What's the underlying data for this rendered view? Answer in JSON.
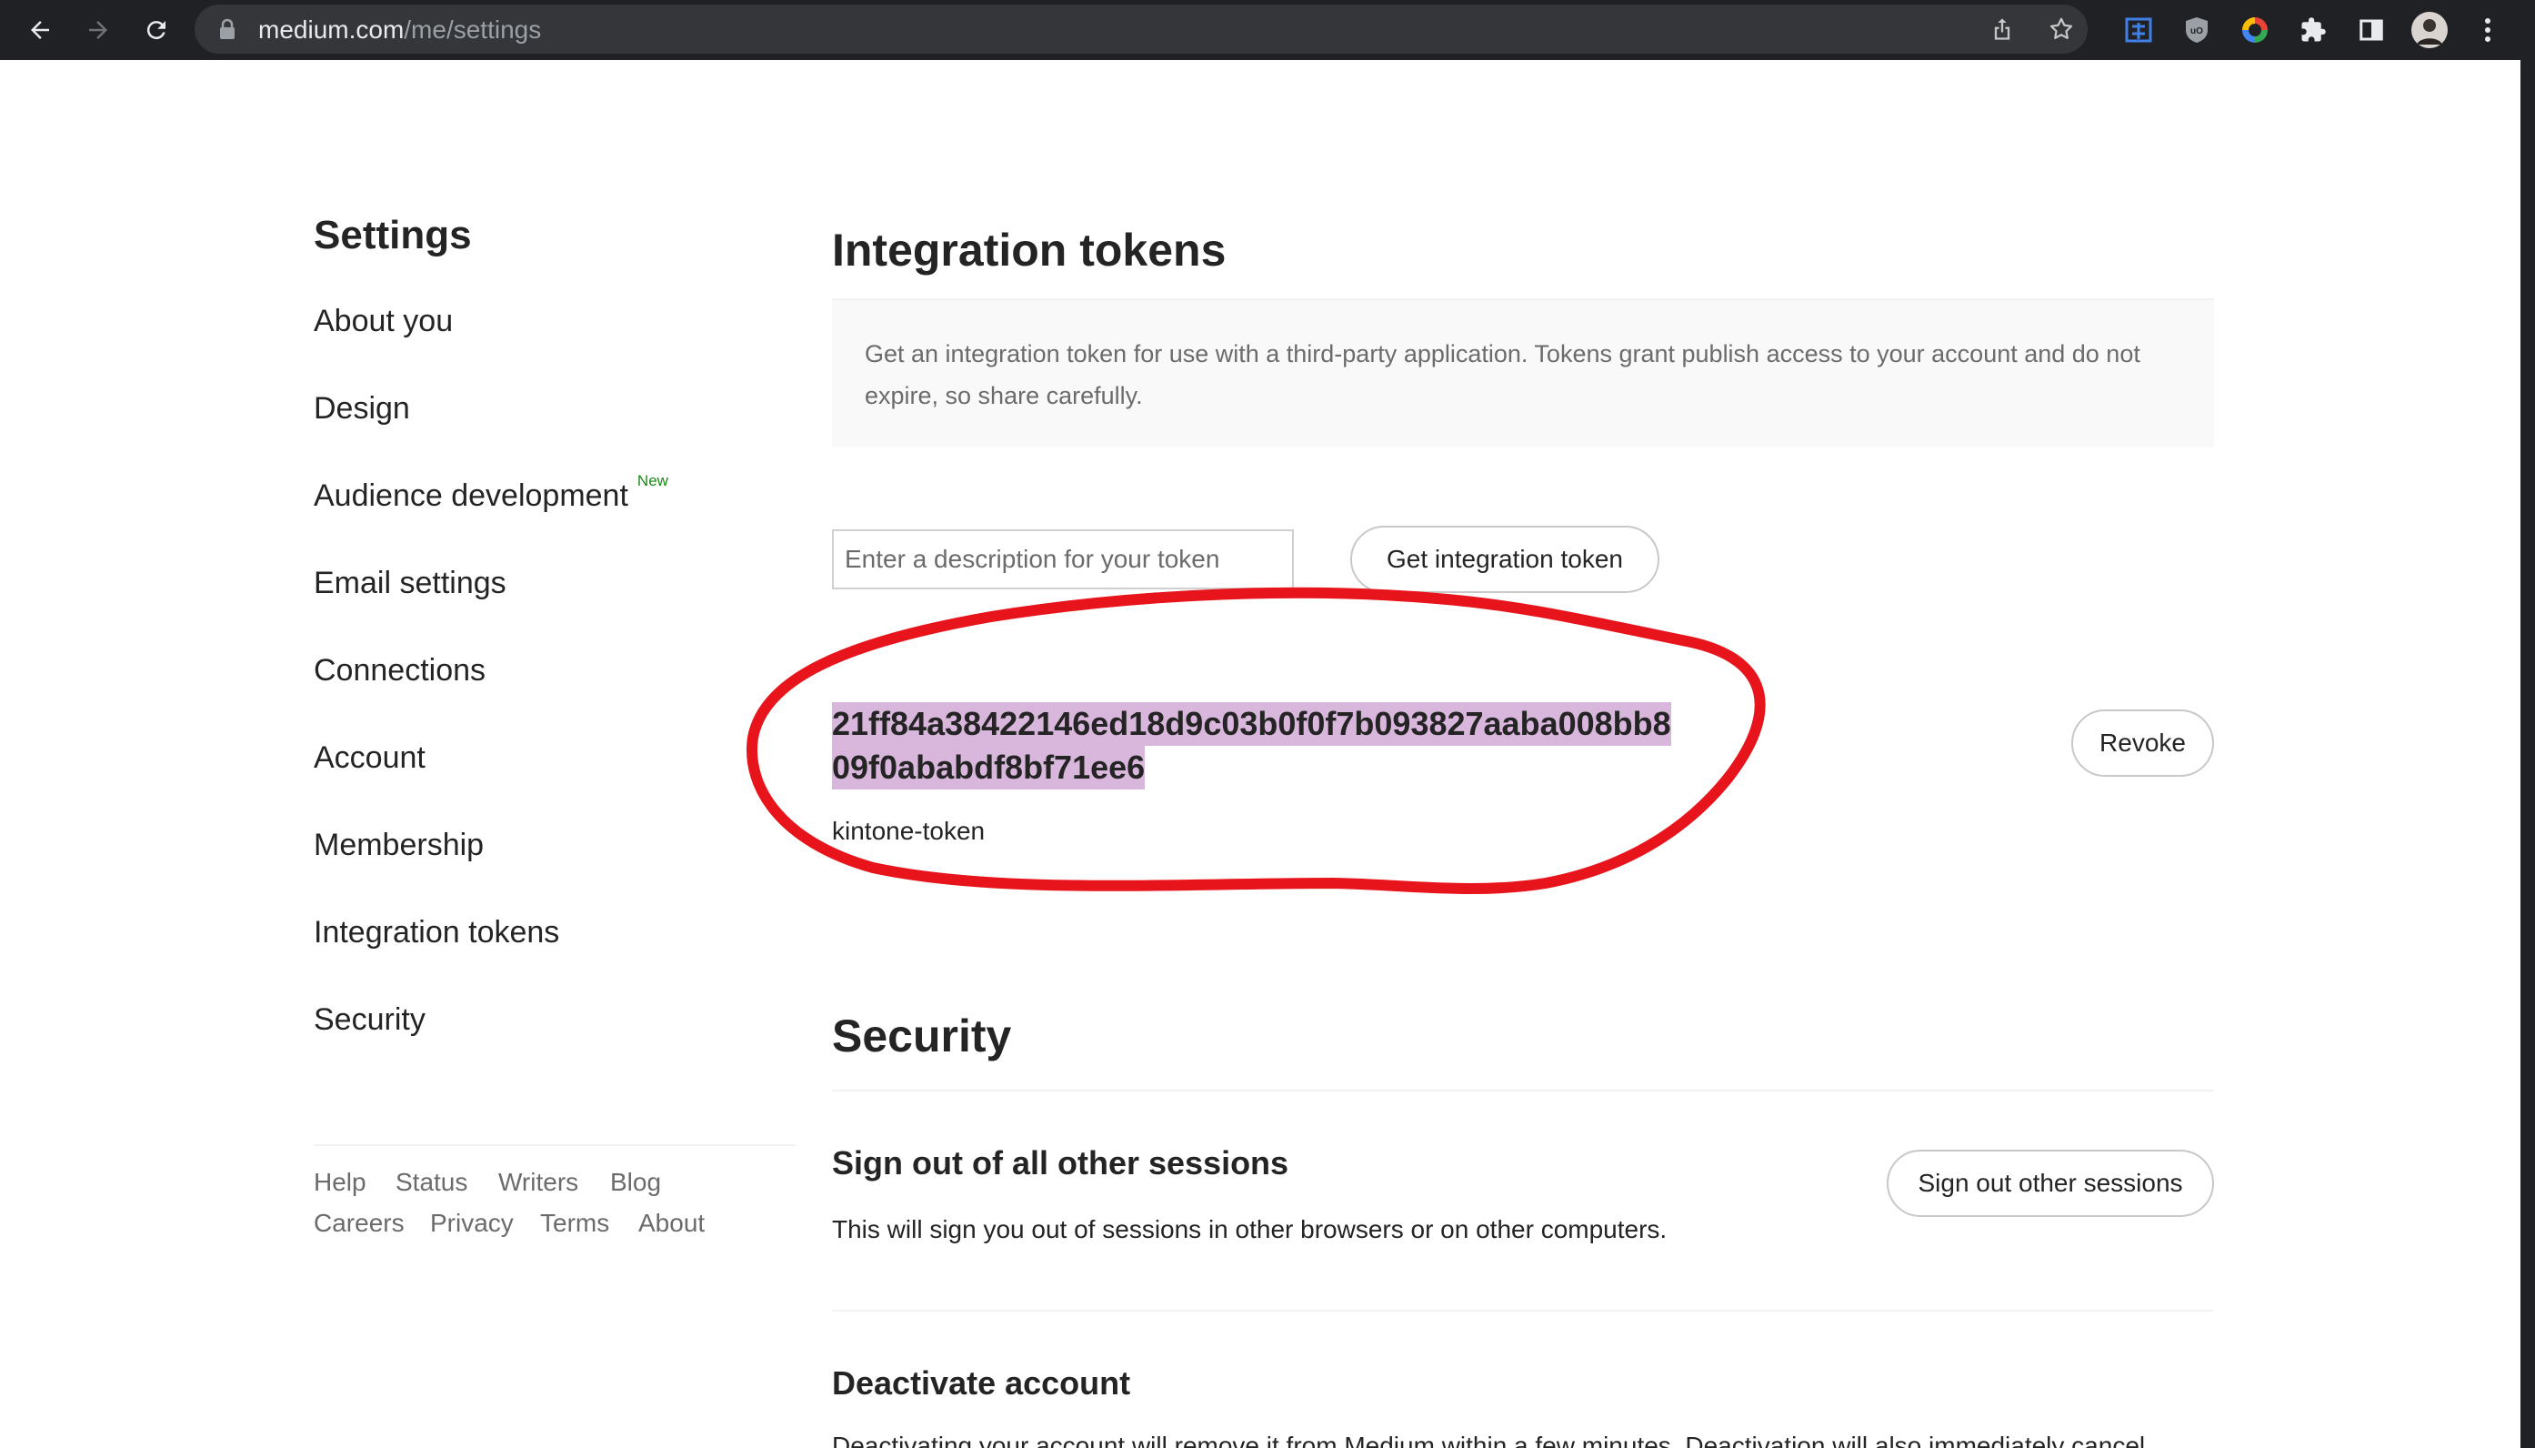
{
  "browser": {
    "url_host": "medium.com",
    "url_path": "/me/settings"
  },
  "sidebar": {
    "title": "Settings",
    "items": [
      {
        "label": "About you"
      },
      {
        "label": "Design"
      },
      {
        "label": "Audience development",
        "badge": "New"
      },
      {
        "label": "Email settings"
      },
      {
        "label": "Connections"
      },
      {
        "label": "Account"
      },
      {
        "label": "Membership"
      },
      {
        "label": "Integration tokens"
      },
      {
        "label": "Security"
      }
    ],
    "footer_links": [
      "Help",
      "Status",
      "Writers",
      "Blog",
      "Careers",
      "Privacy",
      "Terms",
      "About"
    ]
  },
  "integration": {
    "title": "Integration tokens",
    "description": "Get an integration token for use with a third-party application. Tokens grant publish access to your account and do not expire, so share carefully.",
    "input_placeholder": "Enter a description for your token",
    "get_button": "Get integration token",
    "token_line1": "21ff84a38422146ed18d9c03b0f0f7b093827aaba008bb8",
    "token_line2": "09f0ababdf8bf71ee6",
    "token_name": "kintone-token",
    "revoke_button": "Revoke"
  },
  "security": {
    "title": "Security",
    "signout_title": "Sign out of all other sessions",
    "signout_desc": "This will sign you out of sessions in other browsers or on other computers.",
    "signout_button": "Sign out other sessions",
    "deactivate_title": "Deactivate account",
    "deactivate_desc": "Deactivating your account will remove it from Medium within a few minutes. Deactivation will also immediately cancel"
  },
  "colors": {
    "annotation_red": "#e8141b",
    "highlight": "#d9b6dc",
    "new_badge": "#1a8917"
  }
}
